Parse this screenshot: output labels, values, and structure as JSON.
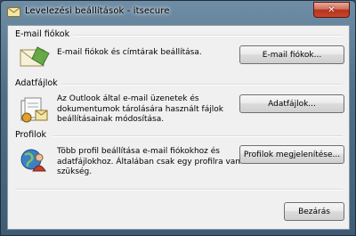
{
  "window": {
    "title": "Levelezési beállítások - itsecure",
    "close_label": "✕"
  },
  "sections": {
    "email": {
      "title": "E-mail fiókok",
      "description": "E-mail fiókok és címtárak beállítása.",
      "button": "E-mail fiókok..."
    },
    "data": {
      "title": "Adatfájlok",
      "description_lines": [
        "Az Outlook által e-mail üzenetek és",
        "dokumentumok tárolására használt fájlok",
        "beállításainak módosítása."
      ],
      "button": "Adatfájlok..."
    },
    "profiles": {
      "title": "Profilok",
      "description_lines": [
        "Több profil beállítása e-mail fiókokhoz és",
        "adatfájlokhoz. Általában csak egy profilra van",
        "szükség."
      ],
      "button": "Profilok megjelenítése..."
    }
  },
  "footer": {
    "close_button": "Bezárás"
  },
  "icons": {
    "app": "mail-setup-icon",
    "email": "envelope-icon",
    "data": "data-files-icon",
    "profiles": "profiles-icon"
  }
}
